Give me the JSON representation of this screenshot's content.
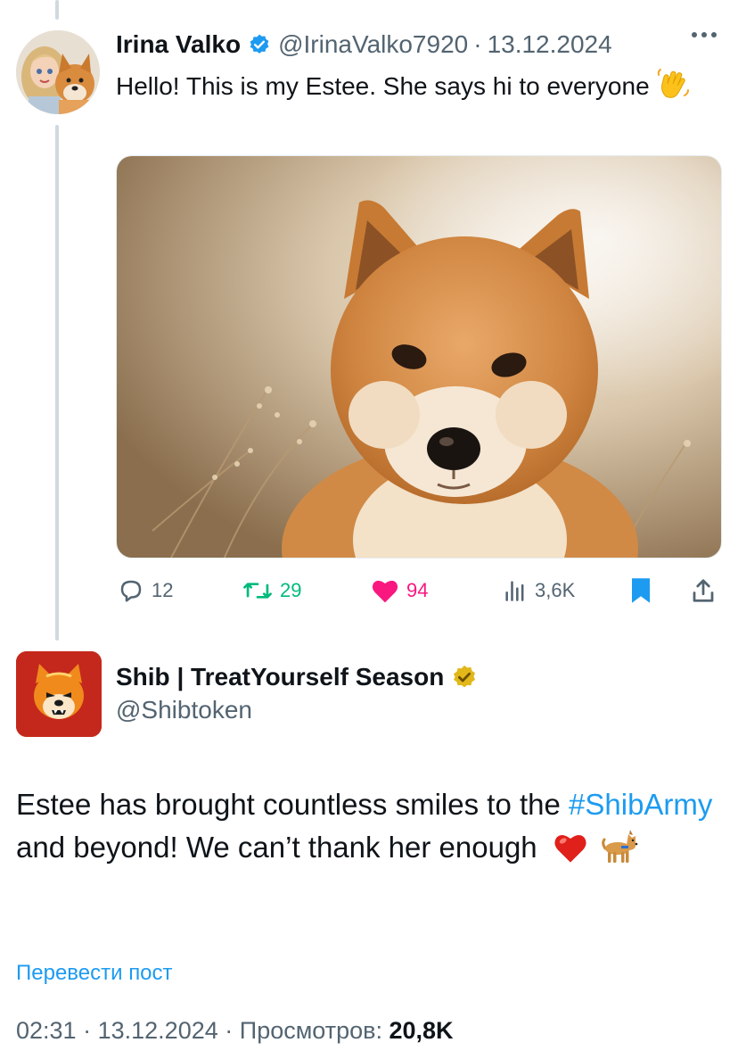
{
  "tweet1": {
    "author_name": "Irina Valko",
    "handle": "@IrinaValko7920",
    "separator": "·",
    "date": "13.12.2024",
    "text": "Hello! This is my Estee. She says hi to everyone",
    "emoji": "waving-hand",
    "photo_subject": "shiba-inu-dog",
    "actions": {
      "replies": "12",
      "reposts": "29",
      "likes": "94",
      "views": "3,6K"
    }
  },
  "tweet2": {
    "author_name": "Shib | TreatYourself Season",
    "handle": "@Shibtoken",
    "text_before": "Estee has brought countless smiles to the ",
    "hashtag": "#ShibArmy",
    "text_after": " and beyond! We can’t thank her enough",
    "emojis": [
      "red-heart",
      "dog"
    ],
    "translate_link": "Перевести пост",
    "time": "02:31",
    "separator": "·",
    "date": "13.12.2024",
    "views_label": "Просмотров:",
    "views_value": "20,8K"
  },
  "colors": {
    "accent": "#1d9bf0",
    "repost": "#00ba7c",
    "like": "#f91880",
    "muted": "#536471",
    "gold_badge": "#e2b719",
    "shib_red": "#c4281c"
  }
}
